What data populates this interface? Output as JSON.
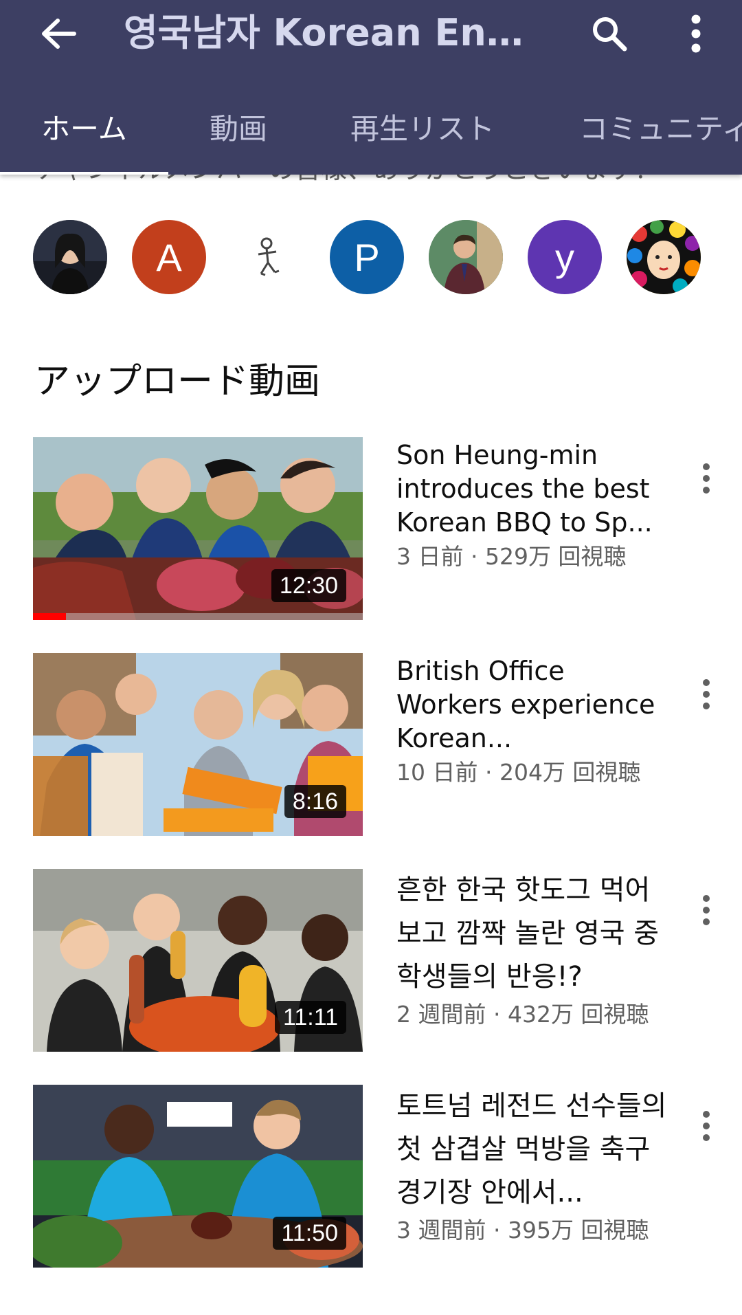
{
  "app_bar": {
    "title": "영국남자 Korean Engli...",
    "tabs": [
      {
        "label": "ホーム",
        "active": true
      },
      {
        "label": "動画",
        "active": false
      },
      {
        "label": "再生リスト",
        "active": false
      },
      {
        "label": "コミュニティ",
        "active": false
      }
    ]
  },
  "members": {
    "partial_text": "チャンネルメンバーの皆様、ありがとうございます！",
    "avatars": [
      {
        "type": "photo",
        "color": "#2b3142"
      },
      {
        "letter": "A",
        "color": "#c23f1c"
      },
      {
        "type": "sketch",
        "color": "#ffffff"
      },
      {
        "letter": "P",
        "color": "#0d5fa6"
      },
      {
        "type": "photo",
        "color": "#4f7a58"
      },
      {
        "letter": "y",
        "color": "#5e35b1"
      },
      {
        "type": "illustration",
        "color": "#e8c23a"
      }
    ]
  },
  "uploads": {
    "section_title": "アップロード動画",
    "videos": [
      {
        "title": "Son Heung-min introduces the best Korean BBQ to Sp...",
        "meta": "3 日前 · 529万 回視聴",
        "duration": "12:30",
        "watched": 0.1
      },
      {
        "title": "British Office Workers experience Korean...",
        "meta": "10 日前 · 204万 回視聴",
        "duration": "8:16"
      },
      {
        "title": "흔한 한국 핫도그 먹어 보고 깜짝 놀란 영국 중학생들의 반응!?",
        "meta": "2 週間前 · 432万 回視聴",
        "duration": "11:11"
      },
      {
        "title": "토트넘 레전드 선수들의 첫 삼겹살 먹방을 축구경기장 안에서...",
        "meta": "3 週間前 · 395万 回視聴",
        "duration": "11:50"
      }
    ]
  },
  "colors": {
    "app_bar": "#3d3f63",
    "progress": "#ff0000"
  }
}
